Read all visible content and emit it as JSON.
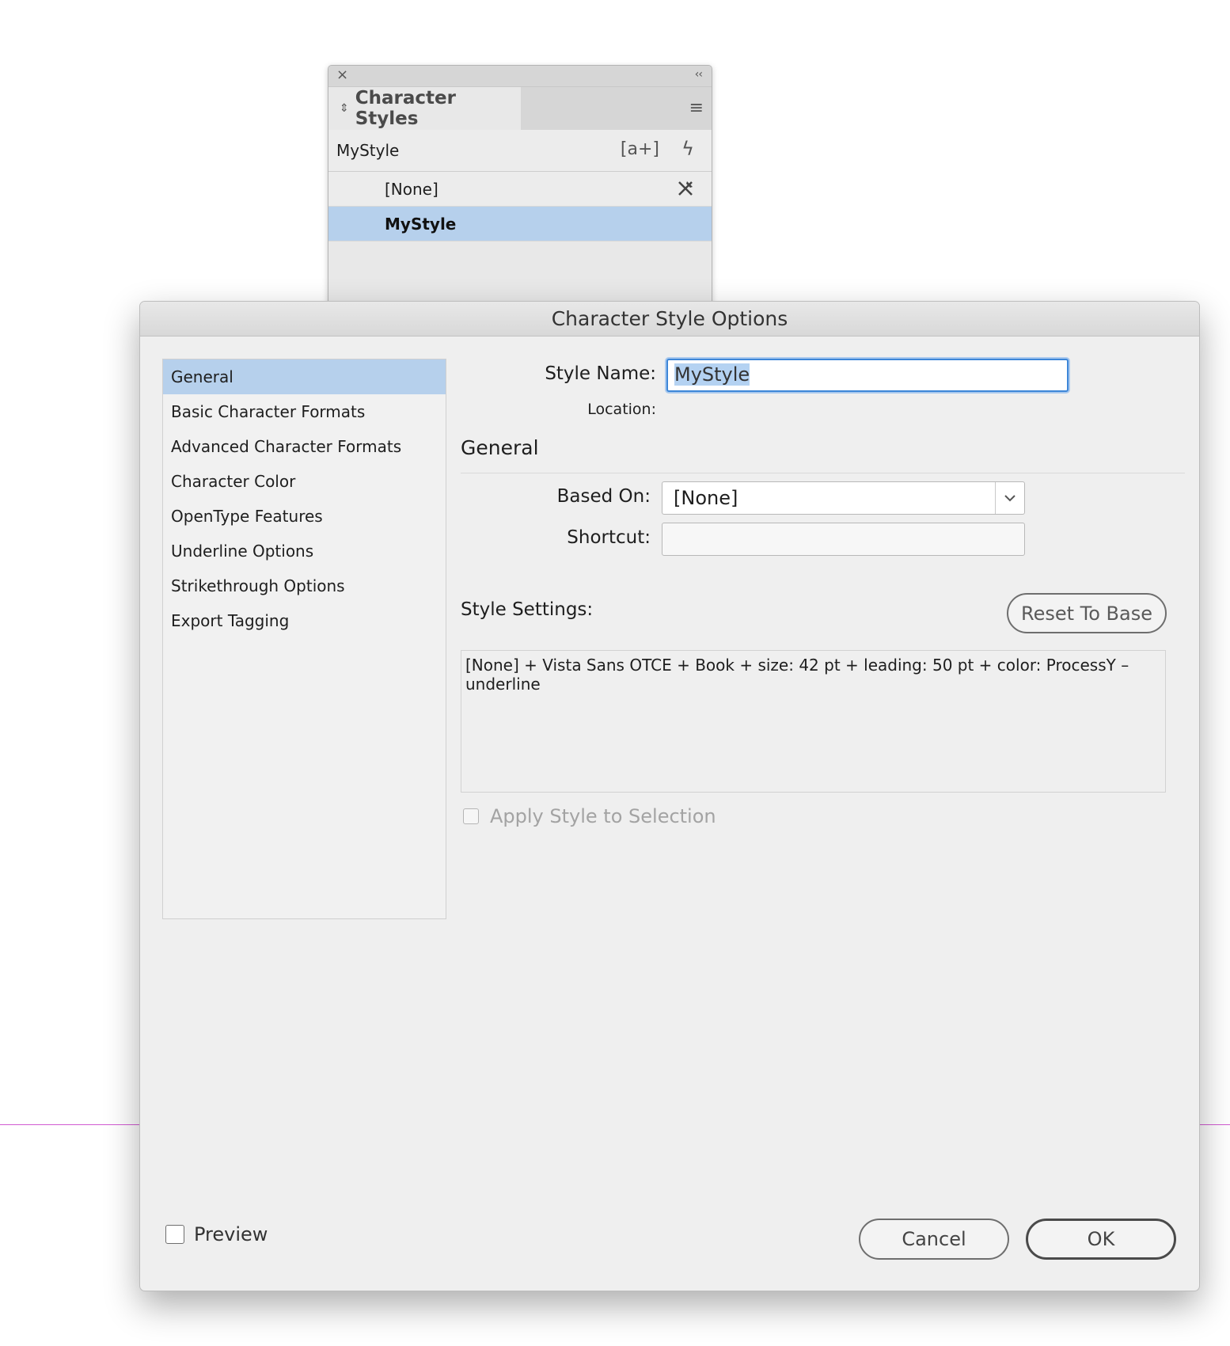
{
  "panel": {
    "tab_label": "Character Styles",
    "current_style": "MyStyle",
    "items": [
      {
        "label": "[None]",
        "selected": false
      },
      {
        "label": "MyStyle",
        "selected": true
      }
    ],
    "icons": {
      "close": "close-icon",
      "collapse": "collapse-icon",
      "menu": "panel-menu-icon",
      "new_style": "new-style-icon",
      "quick_apply": "quick-apply-icon",
      "locked": "locked-style-icon"
    }
  },
  "dialog": {
    "title": "Character Style Options",
    "categories": [
      "General",
      "Basic Character Formats",
      "Advanced Character Formats",
      "Character Color",
      "OpenType Features",
      "Underline Options",
      "Strikethrough Options",
      "Export Tagging"
    ],
    "selected_category": "General",
    "style_name_label": "Style Name:",
    "style_name_value": "MyStyle",
    "location_label": "Location:",
    "section_title": "General",
    "based_on_label": "Based On:",
    "based_on_value": "[None]",
    "shortcut_label": "Shortcut:",
    "shortcut_value": "",
    "style_settings_label": "Style Settings:",
    "reset_button": "Reset To Base",
    "style_settings_text": "[None] + Vista Sans OTCE + Book + size: 42 pt + leading: 50 pt + color: ProcessY – underline",
    "apply_label": "Apply Style to Selection",
    "preview_label": "Preview",
    "cancel_button": "Cancel",
    "ok_button": "OK"
  },
  "colors": {
    "selection": "#b6d0ec",
    "focus_ring": "#3d86d8",
    "guide": "#d25ad2"
  }
}
